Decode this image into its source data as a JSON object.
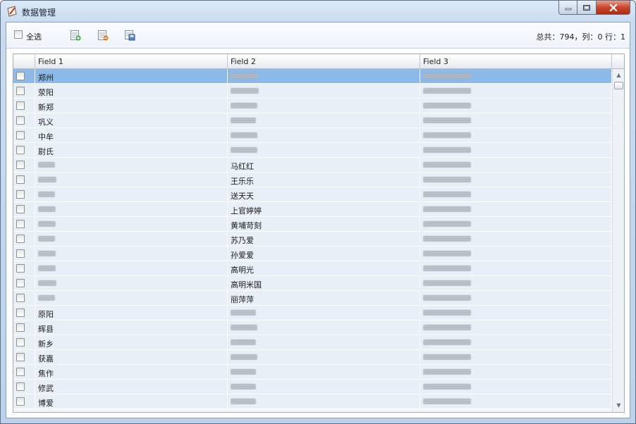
{
  "window": {
    "title": "数据管理",
    "controls": {
      "minimize": "minimize-icon",
      "maximize": "maximize-icon",
      "close": "close-icon"
    }
  },
  "toolbar": {
    "select_all_label": "全选",
    "buttons": [
      "add-record-icon",
      "delete-record-icon",
      "save-record-icon"
    ],
    "status": "总共：794，列：0 行：1"
  },
  "grid": {
    "columns": [
      "Field 1",
      "Field 2",
      "Field 3"
    ],
    "selected_row_index": 0,
    "rows": [
      [
        "郑州",
        "",
        ""
      ],
      [
        "荥阳",
        "",
        ""
      ],
      [
        "新郑",
        "",
        ""
      ],
      [
        "巩义",
        "",
        ""
      ],
      [
        "中牟",
        "",
        ""
      ],
      [
        "尉氏",
        "",
        ""
      ],
      [
        "",
        "马红红",
        ""
      ],
      [
        "",
        "王乐乐",
        ""
      ],
      [
        "",
        "送天天",
        ""
      ],
      [
        "",
        "上官婷婷",
        ""
      ],
      [
        "",
        "黄埔苛刻",
        ""
      ],
      [
        "",
        "苏乃爱",
        ""
      ],
      [
        "",
        "孙爱爱",
        ""
      ],
      [
        "",
        "高明光",
        ""
      ],
      [
        "",
        "高明米国",
        ""
      ],
      [
        "",
        "丽萍萍",
        ""
      ],
      [
        "原阳",
        "",
        ""
      ],
      [
        "辉县",
        "",
        ""
      ],
      [
        "新乡",
        "",
        ""
      ],
      [
        "获嘉",
        "",
        ""
      ],
      [
        "焦作",
        "",
        ""
      ],
      [
        "修武",
        "",
        ""
      ],
      [
        "博爱",
        "",
        ""
      ]
    ]
  },
  "colors": {
    "selected_row": "#8db9e9",
    "row_background": "#e9eff7",
    "close_button": "#c8452d"
  }
}
